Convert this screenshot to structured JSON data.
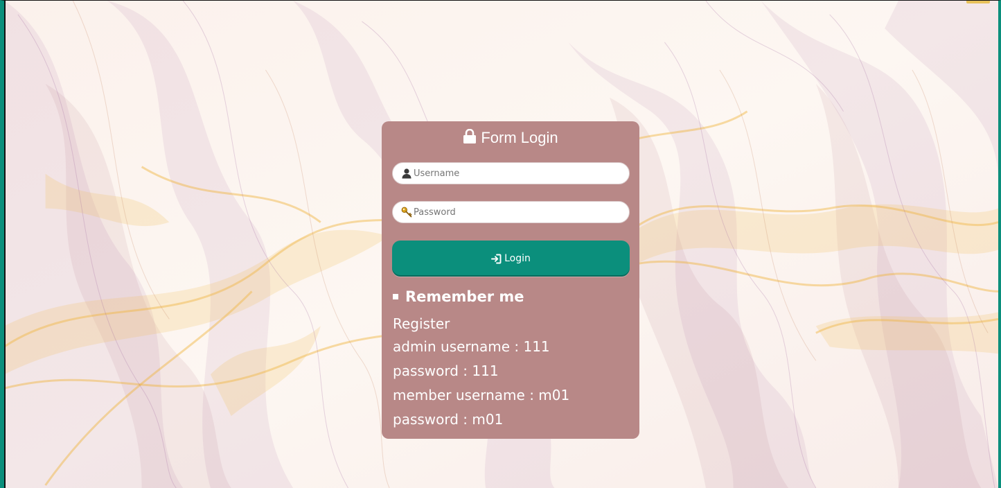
{
  "login_form": {
    "title": "Form Login",
    "username_placeholder": "Username",
    "password_placeholder": "Password",
    "login_label": "Login",
    "remember_label": "Remember me",
    "register_link": "Register",
    "info_lines": [
      "admin username : 111",
      "password : 111",
      "member username : m01",
      "password : m01"
    ]
  },
  "colors": {
    "card_background": "#b88887",
    "login_button": "#0b8f7c",
    "frame_border": "#0b8f7c",
    "text": "#ffffff"
  },
  "icons": {
    "title": "lock-icon",
    "username": "user-icon",
    "password": "key-icon",
    "login": "sign-in-icon",
    "remember": "square-bullet-icon"
  }
}
